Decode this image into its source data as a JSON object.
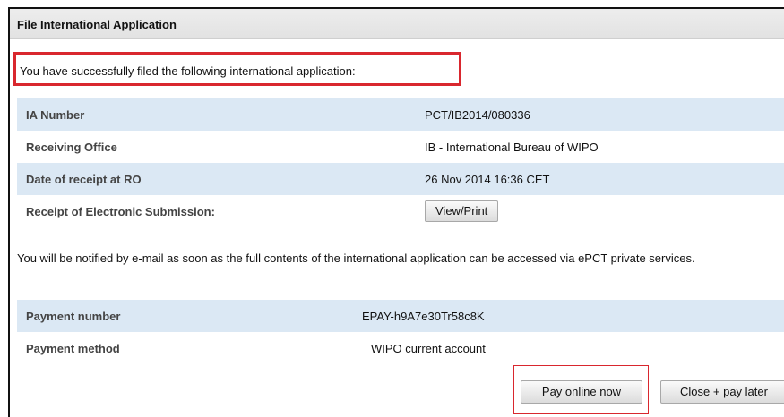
{
  "panel": {
    "title": "File International Application"
  },
  "success_message": "You have successfully filed the following international application:",
  "application": [
    {
      "label": "IA Number",
      "value": "PCT/IB2014/080336"
    },
    {
      "label": "Receiving Office",
      "value": "IB - International Bureau of WIPO"
    },
    {
      "label": "Date of receipt at RO",
      "value": "26 Nov 2014  16:36 CET"
    },
    {
      "label": "Receipt of Electronic Submission:",
      "button": "View/Print"
    }
  ],
  "notice": "You will be notified by e-mail as soon as the full contents of the international application can be accessed via ePCT private services.",
  "payment": [
    {
      "label": "Payment number",
      "value": "EPAY-h9A7e30Tr58c8K"
    },
    {
      "label": "Payment method",
      "value": "WIPO current account"
    }
  ],
  "actions": {
    "pay_now": "Pay online now",
    "close_pay_later": "Close + pay later"
  },
  "colors": {
    "highlight": "#d9272e",
    "row_alt": "#dbe8f4",
    "title_bar": "#e6e6e6"
  }
}
